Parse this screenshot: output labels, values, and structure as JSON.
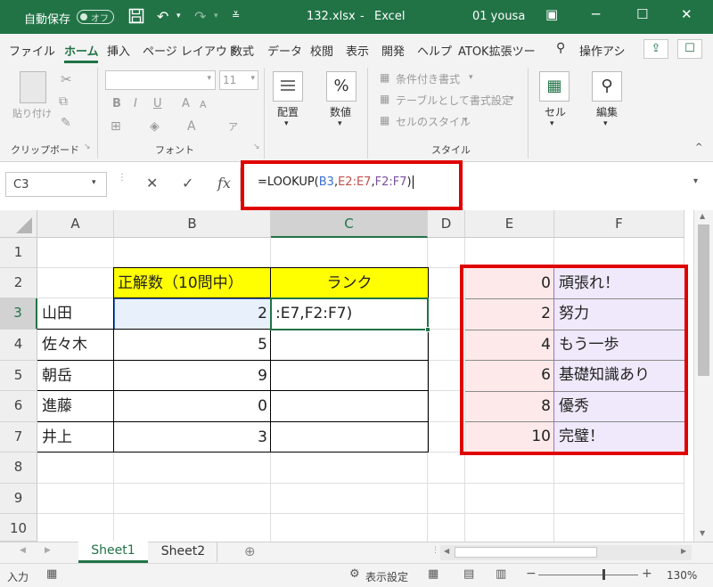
{
  "titlebar": {
    "autosave_label": "自動保存",
    "autosave_state": "オフ",
    "filename": "132.xlsx",
    "sep": "-",
    "app": "Excel",
    "user": "01 yousa"
  },
  "tabs": [
    "ファイル",
    "ホーム",
    "挿入",
    "ページ レイアウト",
    "数式",
    "データ",
    "校閲",
    "表示",
    "開発",
    "ヘルプ",
    "ATOK拡張ツー"
  ],
  "search_label": "操作アシ",
  "ribbon": {
    "paste": "貼り付け",
    "clipboard_group": "クリップボード",
    "font_size": "11",
    "font_group": "フォント",
    "align": "配置",
    "number": "数値",
    "cond_format": "条件付き書式",
    "table_format": "テーブルとして書式設定",
    "cell_style": "セルのスタイル",
    "style_group": "スタイル",
    "cells": "セル",
    "edit": "編集",
    "bold": "B",
    "italic": "I",
    "underline": "U"
  },
  "formula_bar": {
    "name_box": "C3",
    "fx": "fx",
    "f_eq": "=LOOKUP(",
    "f_b3": "B3",
    "f_c1": ",",
    "f_e": "E2:E7",
    "f_c2": ",",
    "f_f": "F2:F7",
    "f_end": ")"
  },
  "columns": [
    "A",
    "B",
    "C",
    "D",
    "E",
    "F"
  ],
  "rows": [
    "1",
    "2",
    "3",
    "4",
    "5",
    "6",
    "7",
    "8",
    "9",
    "10"
  ],
  "table": {
    "header_b": "正解数（10問中）",
    "header_c": "ランク",
    "names": [
      "山田",
      "佐々木",
      "朝岳",
      "進藤",
      "井上"
    ],
    "scores": [
      "2",
      "5",
      "9",
      "0",
      "3"
    ],
    "c3_edit": ":E7,F2:F7)"
  },
  "lookup": {
    "thresholds": [
      "0",
      "2",
      "4",
      "6",
      "8",
      "10"
    ],
    "ranks": [
      "頑張れ！",
      "努力",
      "もう一歩",
      "基礎知識あり",
      "優秀",
      "完璧！"
    ]
  },
  "sheets": [
    "Sheet1",
    "Sheet2"
  ],
  "status": {
    "mode": "入力",
    "display_settings": "表示設定",
    "zoom": "130%"
  },
  "colors": {
    "excel_green": "#217346",
    "yellow": "#ffff00",
    "pink": "#fde9e9",
    "lavender": "#efe9fb",
    "red": "#e00000"
  }
}
